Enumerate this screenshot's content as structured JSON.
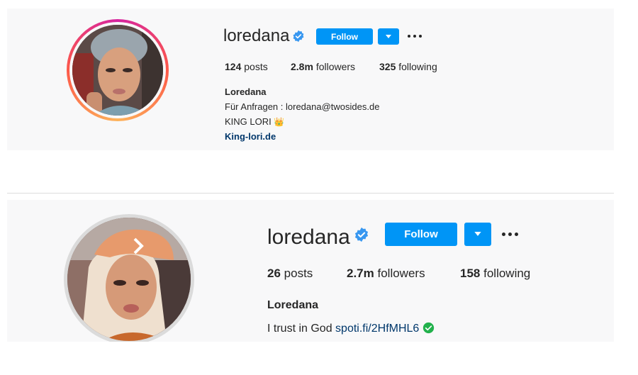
{
  "profile1": {
    "username": "loredana",
    "follow_label": "Follow",
    "stats": {
      "posts_count": "124",
      "posts_label": "posts",
      "followers_count": "2.8m",
      "followers_label": "followers",
      "following_count": "325",
      "following_label": "following"
    },
    "bio": {
      "name": "Loredana",
      "line1": "Für Anfragen : loredana@twosides.de",
      "line2": "KING LORI",
      "line2_emoji": "👑",
      "link": "King-lori.de"
    }
  },
  "profile2": {
    "username": "loredana",
    "follow_label": "Follow",
    "stats": {
      "posts_count": "26",
      "posts_label": "posts",
      "followers_count": "2.7m",
      "followers_label": "followers",
      "following_count": "158",
      "following_label": "following"
    },
    "bio": {
      "name": "Loredana",
      "line1": "I trust in God",
      "link": "spoti.fi/2HfMHL6"
    }
  },
  "icons": {
    "verified": "verified-badge-icon",
    "dropdown": "chevron-down-icon",
    "more": "more-options-icon",
    "check": "check-circle-icon"
  },
  "colors": {
    "follow_blue": "#0095f6",
    "verified_blue": "#3897f0",
    "link_blue": "#00376b",
    "green_check": "#22b14c"
  }
}
